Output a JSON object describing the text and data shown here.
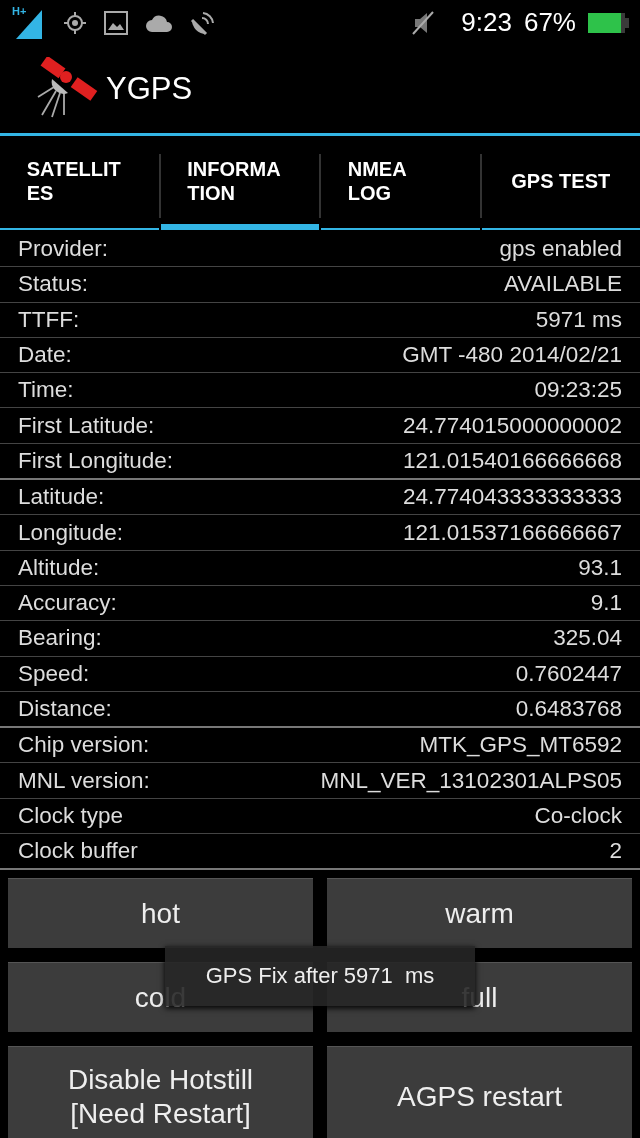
{
  "status_bar": {
    "network": "H+",
    "time": "9:23",
    "battery": "67%"
  },
  "app": {
    "title": "YGPS"
  },
  "tabs": [
    {
      "label": "SATELLIT\nES",
      "selected": false
    },
    {
      "label": "INFORMA\nTION",
      "selected": true
    },
    {
      "label": "NMEA\nLOG",
      "selected": false
    },
    {
      "label": "GPS TEST",
      "selected": false
    }
  ],
  "info_groups": [
    {
      "rows": [
        {
          "label": "Provider:",
          "value": "gps enabled"
        },
        {
          "label": "Status:",
          "value": "AVAILABLE"
        },
        {
          "label": "TTFF:",
          "value": "5971 ms"
        },
        {
          "label": "Date:",
          "value": "GMT -480 2014/02/21"
        },
        {
          "label": "Time:",
          "value": "09:23:25"
        },
        {
          "label": "First Latitude:",
          "value": "24.774015000000002"
        },
        {
          "label": "First Longitude:",
          "value": "121.01540166666668"
        }
      ]
    },
    {
      "rows": [
        {
          "label": "Latitude:",
          "value": "24.774043333333333"
        },
        {
          "label": "Longitude:",
          "value": "121.01537166666667"
        },
        {
          "label": "Altitude:",
          "value": "93.1"
        },
        {
          "label": "Accuracy:",
          "value": "9.1"
        },
        {
          "label": "Bearing:",
          "value": "325.04"
        },
        {
          "label": "Speed:",
          "value": "0.7602447"
        },
        {
          "label": "Distance:",
          "value": "0.6483768"
        }
      ]
    },
    {
      "rows": [
        {
          "label": "Chip version:",
          "value": "MTK_GPS_MT6592"
        },
        {
          "label": "MNL version:",
          "value": "MNL_VER_13102301ALPS05"
        },
        {
          "label": "Clock type",
          "value": "Co-clock"
        },
        {
          "label": "Clock buffer",
          "value": "2"
        }
      ]
    }
  ],
  "buttons": [
    "hot",
    "warm",
    "cold",
    "full",
    "Disable Hotstill\n[Need Restart]",
    "AGPS restart"
  ],
  "toast": "GPS Fix after 5971  ms"
}
